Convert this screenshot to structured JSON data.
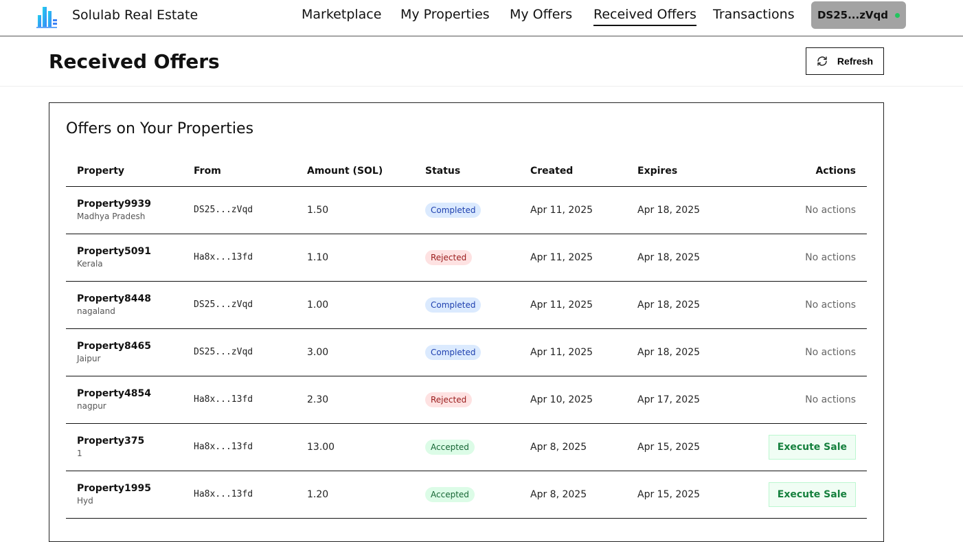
{
  "navbar": {
    "brand": "Solulab Real Estate",
    "links": [
      {
        "label": "Marketplace"
      },
      {
        "label": "My Properties"
      },
      {
        "label": "My Offers"
      },
      {
        "label": "Received Offers",
        "active": true
      },
      {
        "label": "Transactions"
      }
    ],
    "wallet": "DS25...zVqd",
    "wallet_status_color": "#22c55e"
  },
  "page": {
    "title": "Received Offers",
    "refresh_label": "Refresh"
  },
  "card": {
    "title": "Offers on Your Properties",
    "columns": [
      "Property",
      "From",
      "Amount (SOL)",
      "Status",
      "Created",
      "Expires",
      "Actions"
    ],
    "rows": [
      {
        "property": "Property9939",
        "location": "Madhya Pradesh",
        "from": "DS25...zVqd",
        "amount": "1.50",
        "status": "Completed",
        "created": "Apr 11, 2025",
        "expires": "Apr 18, 2025",
        "action": "No actions"
      },
      {
        "property": "Property5091",
        "location": "Kerala",
        "from": "Ha8x...13fd",
        "amount": "1.10",
        "status": "Rejected",
        "created": "Apr 11, 2025",
        "expires": "Apr 18, 2025",
        "action": "No actions"
      },
      {
        "property": "Property8448",
        "location": "nagaland",
        "from": "DS25...zVqd",
        "amount": "1.00",
        "status": "Completed",
        "created": "Apr 11, 2025",
        "expires": "Apr 18, 2025",
        "action": "No actions"
      },
      {
        "property": "Property8465",
        "location": "Jaipur",
        "from": "DS25...zVqd",
        "amount": "3.00",
        "status": "Completed",
        "created": "Apr 11, 2025",
        "expires": "Apr 18, 2025",
        "action": "No actions"
      },
      {
        "property": "Property4854",
        "location": "nagpur",
        "from": "Ha8x...13fd",
        "amount": "2.30",
        "status": "Rejected",
        "created": "Apr 10, 2025",
        "expires": "Apr 17, 2025",
        "action": "No actions"
      },
      {
        "property": "Property375",
        "location": "1",
        "from": "Ha8x...13fd",
        "amount": "13.00",
        "status": "Accepted",
        "created": "Apr 8, 2025",
        "expires": "Apr 15, 2025",
        "action": "Execute Sale"
      },
      {
        "property": "Property1995",
        "location": "Hyd",
        "from": "Ha8x...13fd",
        "amount": "1.20",
        "status": "Accepted",
        "created": "Apr 8, 2025",
        "expires": "Apr 15, 2025",
        "action": "Execute Sale"
      }
    ]
  },
  "icons": {
    "logo": "building-logo-icon",
    "refresh": "refresh-icon"
  }
}
